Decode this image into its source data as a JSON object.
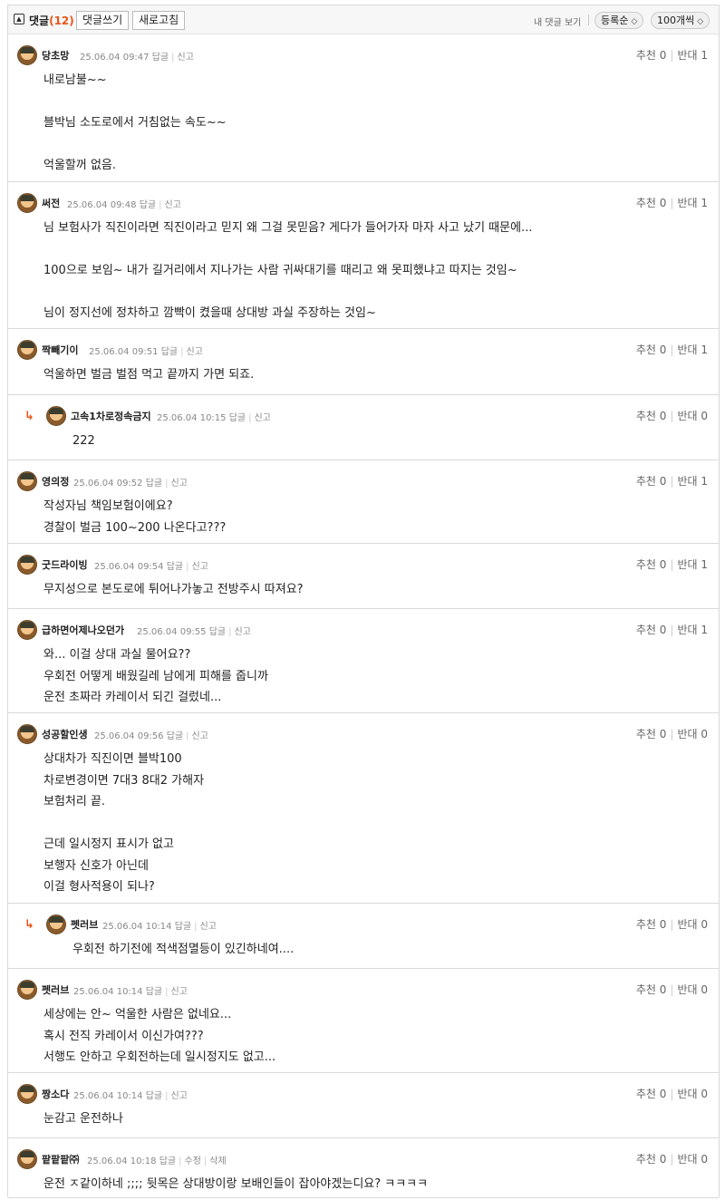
{
  "header": {
    "collapse_icon": "collapse-square-icon",
    "title": "댓글",
    "count": "(12)",
    "write_label": "댓글쓰기",
    "refresh_label": "새로고침",
    "my_comments_label": "내 댓글 보기",
    "sort_label": "등록순",
    "page_size_label": "100개씩",
    "dropdown_icon": "up-down-chevron-icon"
  },
  "comments": [
    {
      "nick": "당초망",
      "date": "25.06.04 09:47",
      "actions": [
        "답글",
        "신고"
      ],
      "up": "추천 0",
      "down": "반대 1",
      "body": "내로남불~~\n\n블박님 소도로에서 거침없는 속도~~\n\n억울할꺼 없음."
    },
    {
      "nick": "써전",
      "date": "25.06.04 09:48",
      "actions": [
        "답글",
        "신고"
      ],
      "up": "추천 0",
      "down": "반대 1",
      "body": "님 보험사가 직진이라면 직진이라고 믿지 왜 그걸 못믿음? 게다가 들어가자 마자 사고 났기 때문에...\n\n100으로 보임~ 내가 길거리에서 지나가는 사람 귀싸대기를 때리고 왜 못피했냐고 따지는 것임~\n\n님이 정지선에 정차하고 깜빡이 켰을때 상대방 과실 주장하는 것임~"
    },
    {
      "nick": "짝빼기이",
      "date": "25.06.04 09:51",
      "actions": [
        "답글",
        "신고"
      ],
      "up": "추천 0",
      "down": "반대 1",
      "body": "억울하면 벌금 벌점 먹고 끝까지 가면 되죠."
    },
    {
      "nick": "고속1차로정속금지",
      "date": "25.06.04 10:15",
      "actions": [
        "답글",
        "신고"
      ],
      "up": "추천 0",
      "down": "반대 0",
      "body": "222",
      "reply": true
    },
    {
      "nick": "영의정",
      "date": "25.06.04 09:52",
      "actions": [
        "답글",
        "신고"
      ],
      "up": "추천 0",
      "down": "반대 1",
      "body": "작성자님 책임보험이에요?\n경찰이 벌금 100~200 나온다고???"
    },
    {
      "nick": "굿드라이빙",
      "date": "25.06.04 09:54",
      "actions": [
        "답글",
        "신고"
      ],
      "up": "추천 0",
      "down": "반대 1",
      "body": "무지성으로 본도로에 튀어나가놓고 전방주시 따져요?"
    },
    {
      "nick": "급하면어제나오던가",
      "date": "25.06.04 09:55",
      "actions": [
        "답글",
        "신고"
      ],
      "up": "추천 0",
      "down": "반대 1",
      "body": "와... 이걸 상대 과실 물어요??\n우회전 어떻게 배웠길레 남에게 피해를 줍니까\n운전 초짜라 카레이서 되긴 걸렀네..."
    },
    {
      "nick": "성공할인생",
      "date": "25.06.04 09:56",
      "actions": [
        "답글",
        "신고"
      ],
      "up": "추천 0",
      "down": "반대 0",
      "body": "상대차가 직진이면 블박100\n차로변경이면 7대3 8대2 가해자\n보험처리 끝.\n\n근데 일시정지 표시가 없고\n보행자 신호가 아닌데\n이걸 형사적용이 되나?"
    },
    {
      "nick": "펫러브",
      "date": "25.06.04 10:14",
      "actions": [
        "답글",
        "신고"
      ],
      "up": "추천 0",
      "down": "반대 0",
      "body": "우회전 하기전에 적색점멸등이 있긴하네여....",
      "reply": true
    },
    {
      "nick": "펫러브",
      "date": "25.06.04 10:14",
      "actions": [
        "답글",
        "신고"
      ],
      "up": "추천 0",
      "down": "반대 0",
      "body": "세상에는 안~ 억울한 사람은 없네요...\n혹시 전직 카레이서 이신가여???\n서행도 안하고 우회전하는데 일시정지도 없고..."
    },
    {
      "nick": "짱소다",
      "date": "25.06.04 10:14",
      "actions": [
        "답글",
        "신고"
      ],
      "up": "추천 0",
      "down": "반대 0",
      "body": "눈감고 운전하나"
    },
    {
      "nick": "팥팥팥㈜",
      "date": "25.06.04 10:18",
      "actions": [
        "답글",
        "수정",
        "삭제"
      ],
      "up": "추천 0",
      "down": "반대 0",
      "body": "운전 ㅈ같이하네 ;;;; 뒷목은 상대방이랑 보배인들이 잡아야겠는디요? ㅋㅋㅋㅋ"
    }
  ],
  "reply_icon": "reply-arrow-icon",
  "avatar_icon": "level-avatar-icon"
}
